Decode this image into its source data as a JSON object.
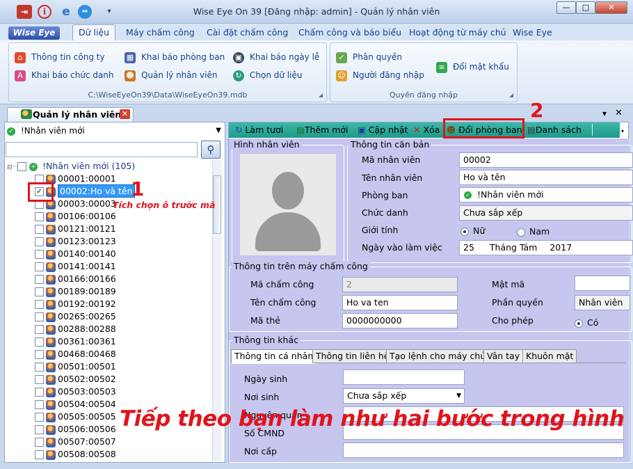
{
  "window": {
    "title": "Wise Eye On 39 [Đăng nhập: admin] - Quản lý nhân viên",
    "minimize": "—",
    "maximize": "□",
    "close": "✕"
  },
  "logo": "Wise Eye",
  "ribbon_tabs": [
    "Dữ liệu",
    "Máy chấm công",
    "Cài đặt chấm công",
    "Chấm công và báo biểu",
    "Hoạt động từ máy chủ",
    "Wise Eye"
  ],
  "ribbon": {
    "group1": {
      "items": [
        "Thông tin công ty",
        "Khai báo phòng ban",
        "Khai báo ngày lễ",
        "Khai báo chức danh",
        "Quản lý nhân viên",
        "Chọn dữ liệu"
      ],
      "caption": "C:\\WiseEyeOn39\\Data\\WiseEyeOn39.mdb"
    },
    "group2": {
      "items": [
        "Phân quyền",
        "Người đăng nhập",
        "Đổi mật khẩu"
      ],
      "caption": "Quyền đăng nhập"
    }
  },
  "doc_tab": {
    "label": "Quản lý nhân viên",
    "close": "✕"
  },
  "pane_controls": {
    "pin": "▾",
    "close": "✕"
  },
  "left": {
    "filter": "!Nhân viên mới",
    "search_icon": "search-icon",
    "tree_root": "!Nhân viên mới (105)",
    "employees": [
      "00001:00001",
      "00002:Ho và tên",
      "00003:00003",
      "00106:00106",
      "00121:00121",
      "00123:00123",
      "00140:00140",
      "00141:00141",
      "00166:00166",
      "00189:00189",
      "00192:00192",
      "00265:00265",
      "00288:00288",
      "00361:00361",
      "00468:00468",
      "00501:00501",
      "00502:00502",
      "00503:00503",
      "00504:00504",
      "00505:00505",
      "00506:00506",
      "00507:00507",
      "00508:00508"
    ],
    "checked_index": 1
  },
  "toolbar": [
    "Làm tươi",
    "Thêm mới",
    "Cập nhật",
    "Xóa",
    "Đổi phòng ban",
    "Danh sách"
  ],
  "photo_section": "Hình nhân viên",
  "basic": {
    "legend": "Thông tin căn bản",
    "ma_nv_label": "Mã nhân viên",
    "ma_nv": "00002",
    "ten_label": "Tên nhân viên",
    "ten": "Ho và tên",
    "phong_label": "Phòng ban",
    "phong": "!Nhân viên mới",
    "chuc_label": "Chức danh",
    "chuc": "Chưa sắp xếp",
    "gioitinh_label": "Giới tính",
    "nu": "Nữ",
    "nam": "Nam",
    "ngay_label": "Ngày vào làm việc",
    "ngay_day": "25",
    "ngay_month": "Tháng Tám",
    "ngay_year": "2017"
  },
  "machine": {
    "legend": "Thông tin trên máy chấm công",
    "ma_cc_label": "Mã chấm công",
    "ma_cc": "2",
    "ten_cc_label": "Tên chấm công",
    "ten_cc": "Ho va ten",
    "ma_the_label": "Mã thẻ",
    "ma_the": "0000000000",
    "matma_label": "Mật mã",
    "matma": "",
    "phanquyen_label": "Phần quyền",
    "phanquyen": "Nhân viên",
    "chophep_label": "Cho phép",
    "chophep": "Có"
  },
  "other": {
    "legend": "Thông tin khác",
    "tabs": [
      "Thông tin cá nhân",
      "Thông tin liên hệ",
      "Tạo lệnh cho máy chủ",
      "Vân tay",
      "Khuôn mặt"
    ],
    "ngaysinh_label": "Ngày sinh",
    "ngaysinh": "",
    "noisinh_label": "Nơi sinh",
    "noisinh": "Chưa sắp xếp",
    "nguyenquan_label": "Nguyên quán",
    "nguyenquan": "",
    "cmnd_label": "Số CMND",
    "cmnd": "",
    "noicap_label": "Nơi cấp",
    "noicap": ""
  },
  "annotations": {
    "step1": "1",
    "step1_text": "Tích chọn ô trước mã",
    "step2": "2",
    "overlay": "Tiếp theo bạn làm như hai bước trong hình"
  },
  "colors": {
    "annotation_red": "#e0141c",
    "toolbar_teal": "#1e9a8b",
    "form_bg": "#c6c6ef",
    "selection": "#3399ff"
  }
}
